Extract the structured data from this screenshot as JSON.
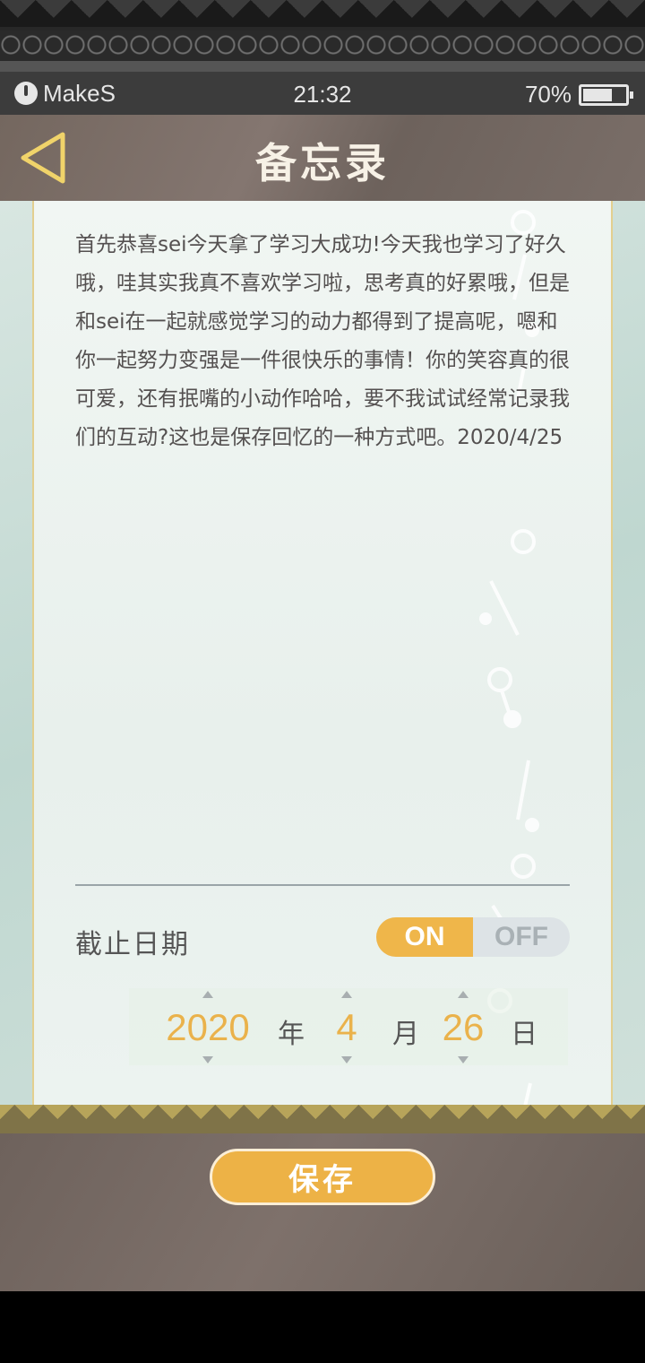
{
  "status_bar": {
    "carrier": "MakeS",
    "time": "21:32",
    "battery_percent": "70%",
    "battery_level": 0.7
  },
  "header": {
    "title": "备忘录",
    "back_icon": "back-triangle-icon"
  },
  "memo": {
    "text": "首先恭喜sei今天拿了学习大成功!今天我也学习了好久哦，哇其实我真不喜欢学习啦，思考真的好累哦，但是和sei在一起就感觉学习的动力都得到了提高呢，嗯和你一起努力变强是一件很快乐的事情！你的笑容真的很可爱，还有抿嘴的小动作哈哈，要不我试试经常记录我们的互动?这也是保存回忆的一种方式吧。2020/4/25"
  },
  "deadline": {
    "label": "截止日期",
    "toggle_on": "ON",
    "toggle_off": "OFF",
    "toggle_state": "on"
  },
  "date": {
    "year": "2020",
    "year_unit": "年",
    "month": "4",
    "month_unit": "月",
    "day": "26",
    "day_unit": "日"
  },
  "footer": {
    "save_label": "保存"
  },
  "colors": {
    "accent": "#EDB246",
    "header_bg": "#7A6E68",
    "paper_bg": "#EEF4F1"
  }
}
